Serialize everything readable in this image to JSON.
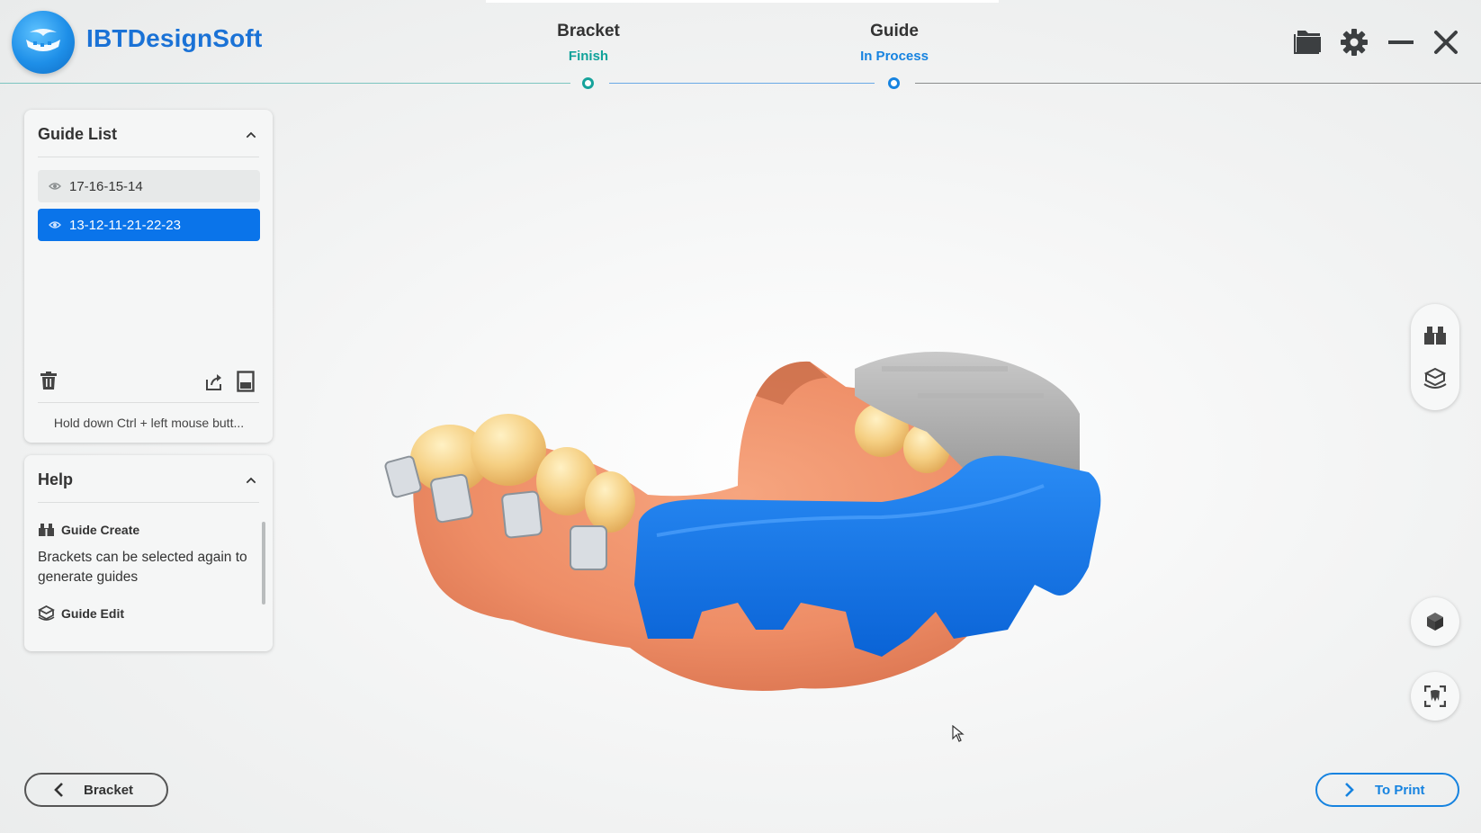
{
  "app": {
    "name": "IBTDesignSoft"
  },
  "steps": [
    {
      "title": "Bracket",
      "status": "Finish"
    },
    {
      "title": "Guide",
      "status": "In Process"
    }
  ],
  "window_icons": [
    "folder-icon",
    "gear-icon",
    "minimize-icon",
    "close-icon"
  ],
  "guide_list": {
    "title": "Guide List",
    "items": [
      {
        "label": "17-16-15-14",
        "selected": false
      },
      {
        "label": "13-12-11-21-22-23",
        "selected": true
      }
    ],
    "hint": "Hold down Ctrl + left mouse butt..."
  },
  "help": {
    "title": "Help",
    "guide_create": {
      "label": "Guide Create",
      "description": "Brackets can be selected again to generate guides"
    },
    "guide_edit": {
      "label": "Guide Edit"
    }
  },
  "nav": {
    "back_label": "Bracket",
    "next_label": "To Print"
  },
  "colors": {
    "accent_blue": "#0a74ea",
    "finish_teal": "#10a29a",
    "guide_blue": "#1683e0",
    "app_name": "#1a72d6"
  }
}
